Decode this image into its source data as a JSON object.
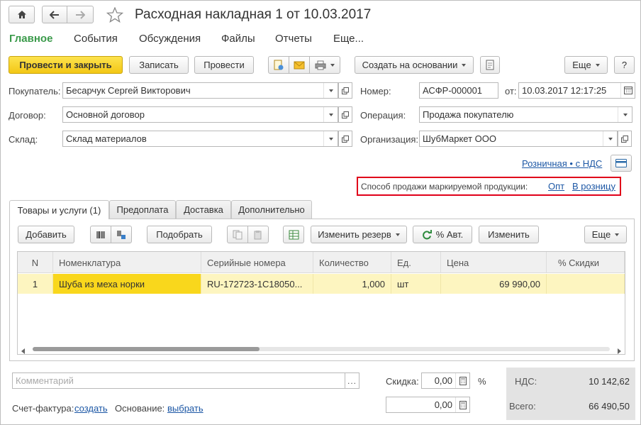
{
  "window": {
    "title": "Расходная накладная 1 от 10.03.2017"
  },
  "menu": {
    "items": [
      "Главное",
      "События",
      "Обсуждения",
      "Файлы",
      "Отчеты",
      "Еще..."
    ],
    "active_color": "#3a9a4a"
  },
  "toolbar": {
    "post_close": "Провести и закрыть",
    "write": "Записать",
    "post": "Провести",
    "create_based": "Создать на основании",
    "more": "Еще",
    "help": "?"
  },
  "form": {
    "buyer_label": "Покупатель:",
    "buyer_value": "Бесарчук Сергей Викторович",
    "contract_label": "Договор:",
    "contract_value": "Основной договор",
    "warehouse_label": "Склад:",
    "warehouse_value": "Склад материалов",
    "number_label": "Номер:",
    "number_value": "АСФР-000001",
    "date_label": "от:",
    "date_value": "10.03.2017 12:17:25",
    "operation_label": "Операция:",
    "operation_value": "Продажа покупателю",
    "org_label": "Организация:",
    "org_value": "ШубМаркет ООО",
    "price_type_link": "Розничная • с НДС",
    "marking_label": "Способ продажи маркируемой продукции:",
    "marking_opt": "Опт",
    "marking_retail": "В розницу",
    "highlight_color": "#e0001a"
  },
  "tabs": [
    "Товары и услуги (1)",
    "Предоплата",
    "Доставка",
    "Дополнительно"
  ],
  "table_toolbar": {
    "add": "Добавить",
    "pick": "Подобрать",
    "change_reserve": "Изменить резерв",
    "auto_pct": "% Авт.",
    "change": "Изменить",
    "more": "Еще"
  },
  "table": {
    "columns": [
      "N",
      "Номенклатура",
      "Серийные номера",
      "Количество",
      "Ед.",
      "Цена",
      "% Скидки"
    ],
    "rows": [
      [
        "1",
        "Шуба из меха норки",
        "RU-172723-1C18050...",
        "1,000",
        "шт",
        "69 990,00",
        ""
      ]
    ]
  },
  "footer": {
    "comment_placeholder": "Комментарий",
    "discount_label": "Скидка:",
    "discount_value": "0,00",
    "percent_sign": "%",
    "amount_value": "0,00",
    "invoice_label": "Счет-фактура:",
    "invoice_link": "создать",
    "basis_label": "Основание:",
    "basis_link": "выбрать",
    "vat_label": "НДС:",
    "vat_value": "10 142,62",
    "total_label": "Всего:",
    "total_value": "66 490,50"
  }
}
